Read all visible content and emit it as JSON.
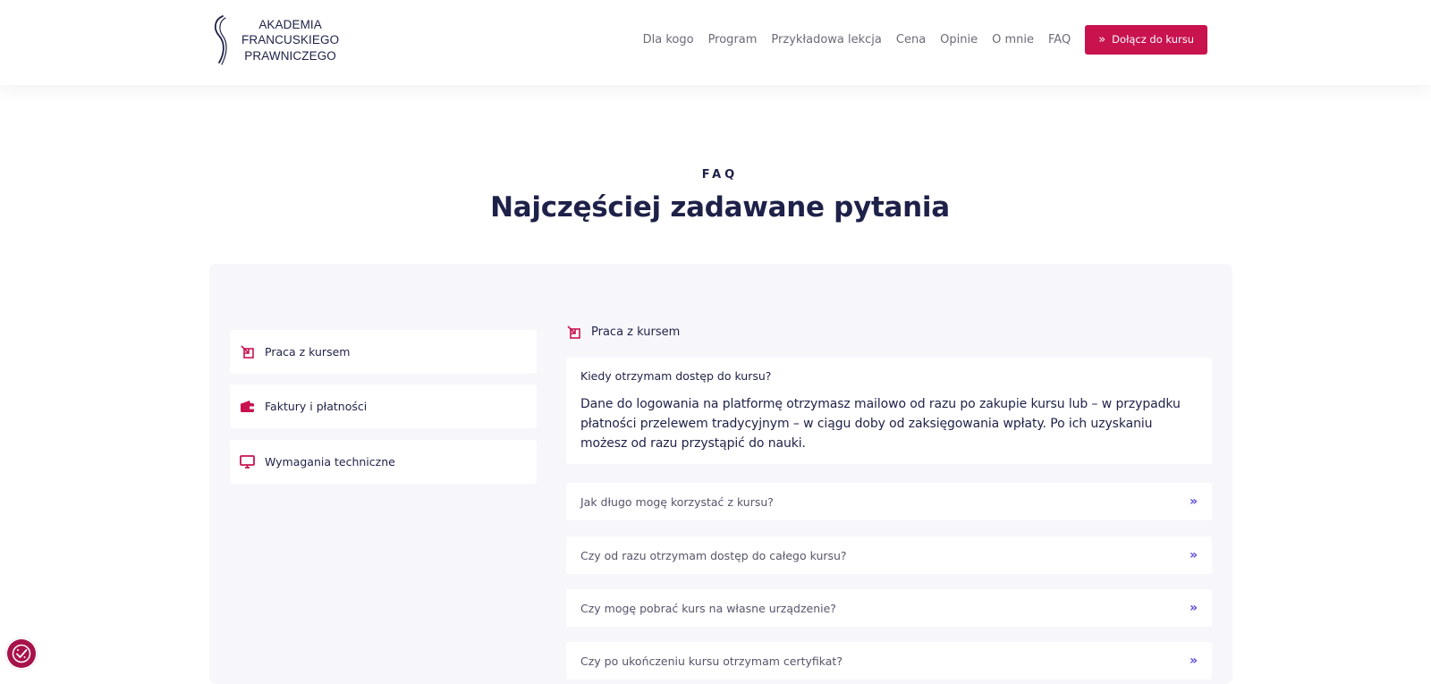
{
  "brand": {
    "logo_lines": [
      "AKADEMIA",
      "FRANCUSKIEGO",
      "PRAWNICZEGO"
    ]
  },
  "nav": {
    "links": [
      "Dla kogo",
      "Program",
      "Przykładowa lekcja",
      "Cena",
      "Opinie",
      "O mnie",
      "FAQ"
    ],
    "cta_label": "Dołącz do kursu",
    "cta_icon": "double-chevron-right-icon"
  },
  "faq": {
    "eyebrow": "FAQ",
    "title": "Najczęściej zadawane pytania",
    "categories": [
      {
        "label": "Praca z kursem",
        "icon": "external-link-icon"
      },
      {
        "label": "Faktury i płatności",
        "icon": "wallet-icon"
      },
      {
        "label": "Wymagania techniczne",
        "icon": "monitor-icon"
      }
    ],
    "active_section": {
      "title": "Praca z kursem",
      "icon": "external-link-icon"
    },
    "open_item": {
      "question": "Kiedy otrzymam dostęp do kursu?",
      "answer": "Dane do logowania na platformę otrzymasz mailowo od razu po zakupie kursu lub – w przypadku płatności przelewem tradycyjnym – w ciągu doby od zaksięgowania wpłaty. Po ich uzyskaniu możesz od razu przystąpić do nauki."
    },
    "items": [
      {
        "question": "Jak długo mogę korzystać z kursu?"
      },
      {
        "question": "Czy od razu otrzymam dostęp do całego kursu?"
      },
      {
        "question": "Czy mogę pobrać kurs na własne urządzenie?"
      },
      {
        "question": "Czy po ukończeniu kursu otrzymam certyfikat?"
      }
    ],
    "chevron": "»"
  },
  "colors": {
    "accent": "#c8134f",
    "navy": "#1e2148",
    "chevron": "#5a4bd8",
    "panel_bg": "#f7f7fb"
  },
  "cookie_button": {
    "icon": "cookie-consent-icon"
  }
}
